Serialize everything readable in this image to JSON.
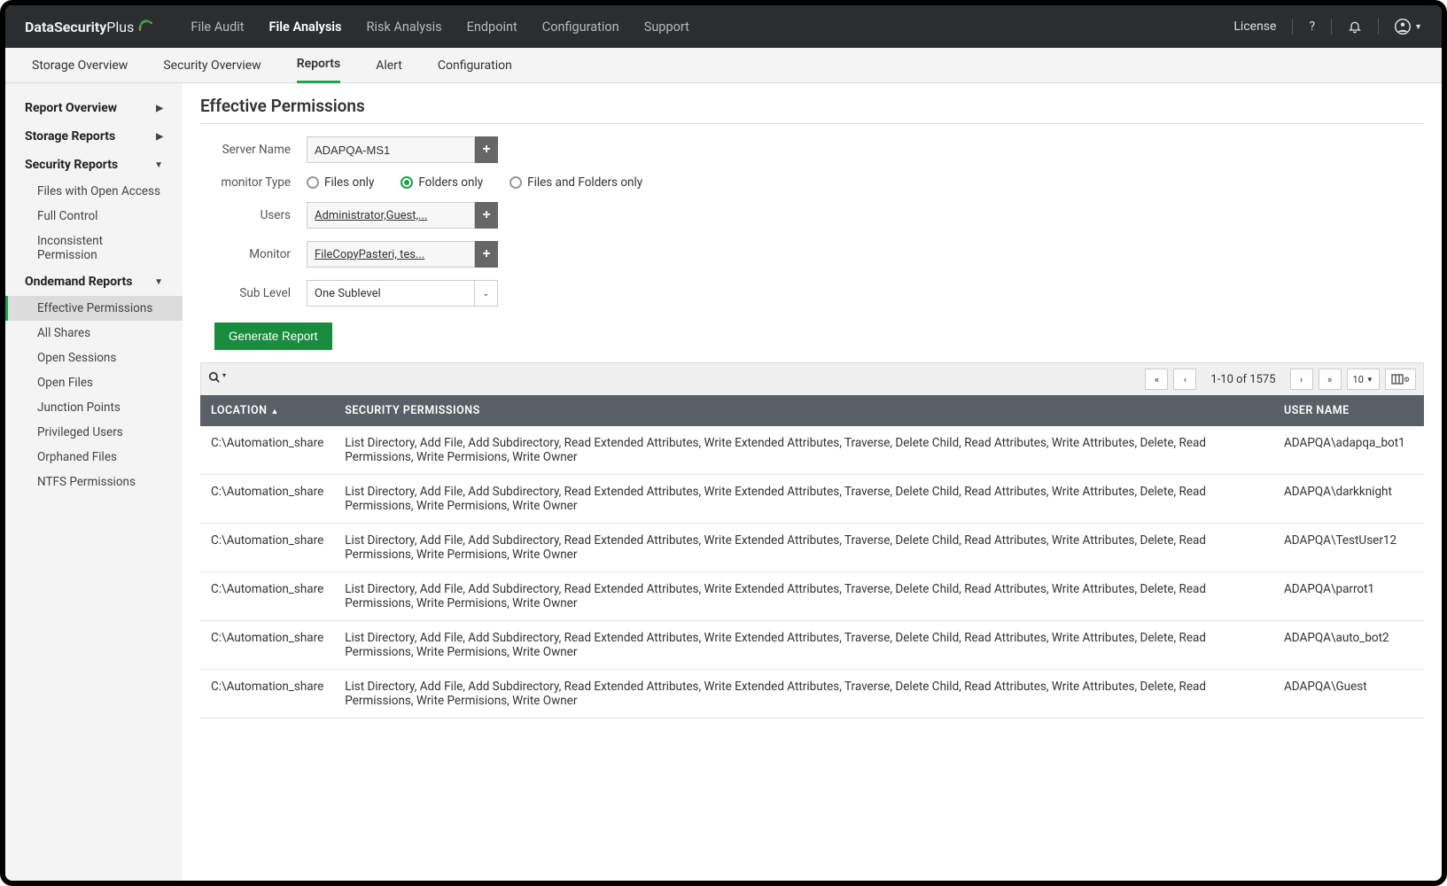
{
  "brand": {
    "part1": "DataSecurity",
    "part2": " Plus"
  },
  "topnav": {
    "tabs": [
      "File Audit",
      "File Analysis",
      "Risk Analysis",
      "Endpoint",
      "Configuration",
      "Support"
    ],
    "active": 1,
    "license": "License"
  },
  "secnav": {
    "tabs": [
      "Storage Overview",
      "Security Overview",
      "Reports",
      "Alert",
      "Configuration"
    ],
    "active": 2
  },
  "sidebar": {
    "groups": [
      {
        "label": "Report Overview",
        "expand": "right",
        "items": []
      },
      {
        "label": "Storage Reports",
        "expand": "right",
        "items": []
      },
      {
        "label": "Security Reports",
        "expand": "down",
        "items": [
          "Files with Open Access",
          "Full Control",
          "Inconsistent Permission"
        ]
      },
      {
        "label": "Ondemand Reports",
        "expand": "down",
        "items": [
          "Effective Permissions",
          "All Shares",
          "Open Sessions",
          "Open Files",
          "Junction Points",
          "Privileged Users",
          "Orphaned Files",
          "NTFS Permissions"
        ],
        "activeItem": 0
      }
    ]
  },
  "page": {
    "title": "Effective Permissions"
  },
  "form": {
    "server_label": "Server Name",
    "server_value": "ADAPQA-MS1",
    "monitor_type_label": "monitor Type",
    "radios": [
      "Files only",
      "Folders only",
      "Files and Folders only"
    ],
    "radio_selected": 1,
    "users_label": "Users",
    "users_value": "Administrator,Guest,...",
    "monitor_label": "Monitor",
    "monitor_value": "FileCopyPasteri, tes...",
    "sublevel_label": "Sub Level",
    "sublevel_value": "One Sublevel",
    "generate": "Generate Report"
  },
  "toolbar": {
    "range": "1-10 of 1575",
    "pagesize": "10"
  },
  "table": {
    "headers": {
      "location": "LOCATION",
      "perms": "SECURITY PERMISSIONS",
      "user": "USER NAME"
    },
    "perms_text": "List Directory, Add File, Add Subdirectory, Read Extended Attributes, Write Extended Attributes, Traverse, Delete Child, Read Attributes, Write Attributes, Delete, Read Permissions, Write Permisions, Write Owner",
    "rows": [
      {
        "location": "C:\\Automation_share",
        "user": "ADAPQA\\adapqa_bot1"
      },
      {
        "location": "C:\\Automation_share",
        "user": "ADAPQA\\darkknight"
      },
      {
        "location": "C:\\Automation_share",
        "user": "ADAPQA\\TestUser12"
      },
      {
        "location": "C:\\Automation_share",
        "user": "ADAPQA\\parrot1"
      },
      {
        "location": "C:\\Automation_share",
        "user": "ADAPQA\\auto_bot2"
      },
      {
        "location": "C:\\Automation_share",
        "user": "ADAPQA\\Guest"
      }
    ]
  }
}
